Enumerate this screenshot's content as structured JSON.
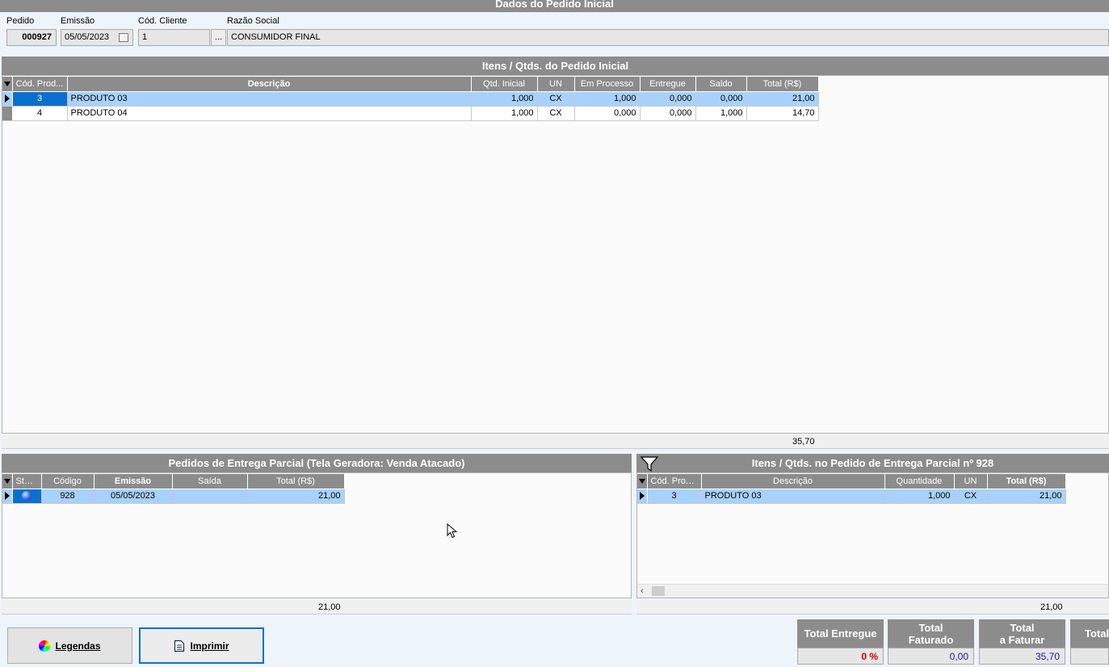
{
  "header": {
    "title": "Dados do Pedido Inicial",
    "pedido_label": "Pedido",
    "pedido_value": "000927",
    "emissao_label": "Emissão",
    "emissao_value": "05/05/2023",
    "cod_cliente_label": "Cód. Cliente",
    "cod_cliente_value": "1",
    "lookup_label": "...",
    "razao_label": "Razão Social",
    "razao_value": "CONSUMIDOR FINAL"
  },
  "items_grid": {
    "title": "Itens / Qtds. do Pedido Inicial",
    "columns": [
      "Cód. Prod...",
      "Descrição",
      "Qtd. Inicial",
      "UN",
      "Em Processo",
      "Entregue",
      "Saldo",
      "Total (R$)"
    ],
    "rows": [
      {
        "cod": "3",
        "desc": "PRODUTO 03",
        "qtd": "1,000",
        "un": "CX",
        "proc": "1,000",
        "entregue": "0,000",
        "saldo": "0,000",
        "total": "21,00"
      },
      {
        "cod": "4",
        "desc": "PRODUTO 04",
        "qtd": "1,000",
        "un": "CX",
        "proc": "0,000",
        "entregue": "0,000",
        "saldo": "1,000",
        "total": "14,70"
      }
    ],
    "footer_total": "35,70"
  },
  "partial_orders": {
    "title": "Pedidos de Entrega Parcial (Tela Geradora: Venda Atacado)",
    "columns": [
      "Stat...",
      "Código",
      "Emissão",
      "Saída",
      "Total (R$)"
    ],
    "rows": [
      {
        "status_icon": "blue-globe-icon",
        "codigo": "928",
        "emissao": "05/05/2023",
        "saida": "",
        "total": "21,00"
      }
    ],
    "footer_total": "21,00"
  },
  "partial_items": {
    "title": "Itens / Qtds. no Pedido de Entrega Parcial nº 928",
    "columns": [
      "Cód. Prod...",
      "Descrição",
      "Quantidade",
      "UN",
      "Total (R$)"
    ],
    "rows": [
      {
        "cod": "3",
        "desc": "PRODUTO 03",
        "qtd": "1,000",
        "un": "CX",
        "total": "21,00"
      }
    ],
    "footer_total": "21,00"
  },
  "buttons": {
    "legendas": "Legendas",
    "imprimir": "Imprimir"
  },
  "totals": {
    "entregue_label": "Total Entregue",
    "entregue_value": "0 %",
    "faturado_label_1": "Total",
    "faturado_label_2": "Faturado",
    "faturado_value": "0,00",
    "a_faturar_label_1": "Total",
    "a_faturar_label_2": "a Faturar",
    "a_faturar_value": "35,70",
    "extra_label": "Total"
  },
  "colors": {
    "header_gray": "#8c8c8c",
    "selection_blue": "#a8d1fb",
    "accent_blue": "#0b6fcf",
    "negative_red": "#cc0000",
    "value_blue": "#1a1aa6"
  }
}
